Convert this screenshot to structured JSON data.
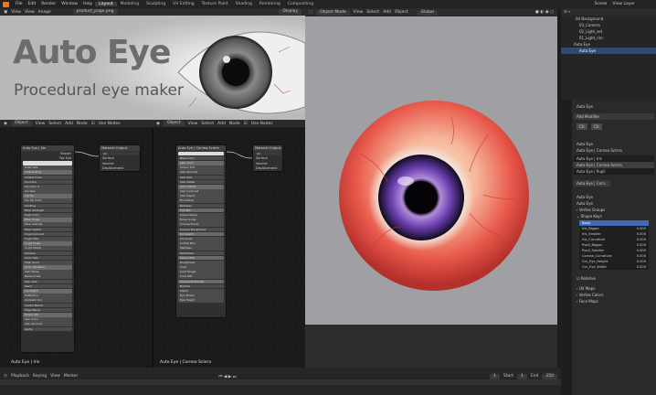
{
  "menu": [
    "File",
    "Edit",
    "Render",
    "Window",
    "Help"
  ],
  "workspaces": [
    "Layout",
    "Modeling",
    "Sculpting",
    "UV Editing",
    "Texture Paint",
    "Shading",
    "Rendering",
    "Compositing"
  ],
  "active_workspace": "Layout",
  "scene": "Scene",
  "view_layer": "View Layer",
  "image_editor": {
    "menus": [
      "View",
      "View",
      "Image"
    ],
    "filename": "product_page.png",
    "display": "Display",
    "banner_title": "Auto Eye",
    "banner_subtitle": "Procedural eye maker"
  },
  "node_editor": {
    "object": "Object",
    "menus": [
      "View",
      "Select",
      "Add",
      "Node"
    ],
    "use_nodes": "Use Nodes",
    "left_panel_label": "Auto Eye | Iris",
    "right_panel_label": "Auto Eye | Cornea Sclera"
  },
  "nodes": {
    "left_group": {
      "title": "Auto Eye | Iris",
      "out": "Shader",
      "out2": "Fac Eye"
    },
    "left_output": {
      "title": "Material Output",
      "items": [
        "All",
        "Surface",
        "Volume",
        "Displacement"
      ]
    },
    "right_group": {
      "title": "Auto Eye | Cornea Sclera"
    },
    "right_output": {
      "title": "Material Output",
      "items": [
        "All",
        "Surface",
        "Volume",
        "Displacement"
      ]
    }
  },
  "left_rows": [
    "Auto Eye | Iris",
    "Pupil Size",
    "Limbal Ring",
    "Limbal Color",
    "Iris Color",
    "Iris Color 2",
    "Iris Vein",
    "Iris Tip",
    "Iris Tip Color",
    "Iris Ring",
    "Fiber Strength",
    "Pupil Color",
    "Fiber Scale",
    "Fiber Density",
    "Fiber Distort",
    "Crypt Amount",
    "Crypt Size",
    "Crypt Scale",
    "Crypt Depth",
    "Shadow",
    "Anim Size",
    "Pupil Anim",
    "Color Variation",
    "Vein Noise",
    "Noise Scale",
    "Vein Size",
    "Seed",
    "Iris Depth",
    "Reflection",
    "Ambient Occ",
    "Center Blend",
    "Edge Blend",
    "Sclera Mix",
    "Vein Color",
    "Vein Amount",
    "Alpha"
  ],
  "right_rows": [
    "Auto Eye | Cornea Sclera",
    "Base Color",
    "Vein Color",
    "Sclera Tint",
    "Vein Amount",
    "Vein Size",
    "Vein Detail",
    "Vein Distort",
    "Vein Contrast",
    "Vein Depth",
    "Bloodshot",
    "Redness",
    "Tint Mix",
    "Sclera Noise",
    "Noise Scale",
    "Cornea Bump",
    "Cornea Roughness",
    "Iris Depth",
    "Iris Scale",
    "Limbal Blur",
    "Wetness",
    "Refraction",
    "Sclera SSS",
    "Roughness",
    "Coat",
    "Coat Rough",
    "Coat IOR",
    "Clearcoat Normal",
    "Normal",
    "Alpha",
    "Eye Sheen",
    "Eye Height"
  ],
  "viewport": {
    "mode": "Object Mode",
    "menus": [
      "View",
      "Select",
      "Add",
      "Object"
    ],
    "orientation": "Global"
  },
  "outliner": {
    "items": [
      {
        "label": "Background",
        "num": "04"
      },
      {
        "label": "03_Camera"
      },
      {
        "label": "02_Light_set"
      },
      {
        "label": "01_Light_rim"
      },
      {
        "label": "Auto Eye"
      },
      {
        "label": "Auto Eye"
      }
    ]
  },
  "properties": {
    "object_name": "Auto Eye",
    "add_modifier": "Add Modifier",
    "mod_fields": [
      "Ctr",
      "Ctr"
    ],
    "data_name": "Auto Eye",
    "material_name": "Auto Eye | Cornea Sclera",
    "materials": [
      "Auto Eye | Iris",
      "Auto Eye | Cornea Sclera",
      "Auto Eye | Pupil"
    ],
    "material_slot": "Auto Eye | Corn..",
    "data_object": "Auto Eye",
    "mesh": "Auto Eye",
    "sections": [
      "Vertex Groups",
      "Shape Keys"
    ],
    "shape_keys": [
      {
        "name": "Basis",
        "value": ""
      },
      {
        "name": "Iris_Bigger",
        "value": "0.000"
      },
      {
        "name": "Iris_Smaller",
        "value": "0.000"
      },
      {
        "name": "Iris_Curvature",
        "value": "0.000"
      },
      {
        "name": "Pupil_Bigger",
        "value": "0.000"
      },
      {
        "name": "Pupil_Smaller",
        "value": "0.000"
      },
      {
        "name": "Cornea_Curvature",
        "value": "0.000"
      },
      {
        "name": "Cor_Eye_Height",
        "value": "0.000"
      },
      {
        "name": "Cor_Eye_Width",
        "value": "0.000"
      }
    ],
    "relative": "Relative",
    "bottom_sections": [
      "UV Maps",
      "Vertex Colors",
      "Face Maps"
    ]
  },
  "timeline": {
    "menus": [
      "Playback",
      "Keying",
      "View",
      "Marker"
    ],
    "current_frame": "1",
    "start_label": "Start",
    "start": "1",
    "end_label": "End",
    "end": "250"
  },
  "colors": {
    "accent": "#e87d0d",
    "selection": "#3f6cb5",
    "sclera_red": "#e8574a",
    "iris_purple": "#6b3fb0"
  }
}
